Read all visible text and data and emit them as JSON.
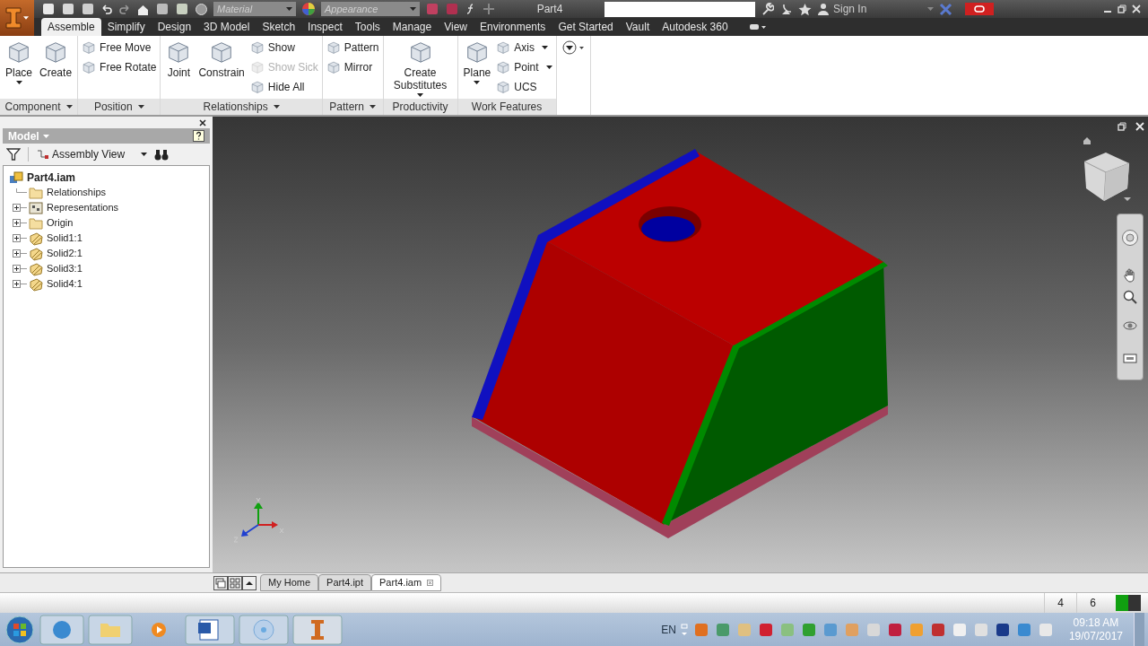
{
  "window": {
    "title": "Part4"
  },
  "quick_access": {
    "material": "Material",
    "appearance": "Appearance"
  },
  "title_bar": {
    "sign_in": "Sign In"
  },
  "tabs": [
    {
      "label": "Assemble",
      "selected": true
    },
    {
      "label": "Simplify",
      "selected": false
    },
    {
      "label": "Design",
      "selected": false
    },
    {
      "label": "3D Model",
      "selected": false
    },
    {
      "label": "Sketch",
      "selected": false
    },
    {
      "label": "Inspect",
      "selected": false
    },
    {
      "label": "Tools",
      "selected": false
    },
    {
      "label": "Manage",
      "selected": false
    },
    {
      "label": "View",
      "selected": false
    },
    {
      "label": "Environments",
      "selected": false
    },
    {
      "label": "Get Started",
      "selected": false
    },
    {
      "label": "Vault",
      "selected": false
    },
    {
      "label": "Autodesk 360",
      "selected": false
    }
  ],
  "ribbon": {
    "groups": [
      {
        "label": "Component",
        "dropdown": true,
        "columns": [
          [
            {
              "label": "Place",
              "kind": "large",
              "dropdown": true,
              "disabled": false
            }
          ],
          [
            {
              "label": "Create",
              "kind": "large",
              "dropdown": false,
              "disabled": false
            }
          ]
        ]
      },
      {
        "label": "Position",
        "dropdown": true,
        "columns": [
          [
            {
              "label": "Free Move",
              "kind": "small",
              "dropdown": false,
              "disabled": false
            },
            {
              "label": "Free Rotate",
              "kind": "small",
              "dropdown": false,
              "disabled": false
            }
          ]
        ]
      },
      {
        "label": "Relationships",
        "dropdown": true,
        "columns": [
          [
            {
              "label": "Joint",
              "kind": "large",
              "dropdown": false,
              "disabled": false
            }
          ],
          [
            {
              "label": "Constrain",
              "kind": "large",
              "dropdown": false,
              "disabled": false
            }
          ],
          [
            {
              "label": "Show",
              "kind": "small",
              "dropdown": false,
              "disabled": false
            },
            {
              "label": "Show Sick",
              "kind": "small",
              "dropdown": false,
              "disabled": true
            },
            {
              "label": "Hide All",
              "kind": "small",
              "dropdown": false,
              "disabled": false
            }
          ]
        ]
      },
      {
        "label": "Pattern",
        "dropdown": true,
        "columns": [
          [
            {
              "label": "Pattern",
              "kind": "small",
              "dropdown": false,
              "disabled": false
            },
            {
              "label": "Mirror",
              "kind": "small",
              "dropdown": false,
              "disabled": false
            }
          ]
        ]
      },
      {
        "label": "Productivity",
        "dropdown": false,
        "columns": [
          [
            {
              "label": "Create Substitutes",
              "kind": "large",
              "dropdown": true,
              "disabled": false
            }
          ]
        ]
      },
      {
        "label": "Work Features",
        "dropdown": false,
        "columns": [
          [
            {
              "label": "Plane",
              "kind": "large",
              "dropdown": true,
              "disabled": false
            }
          ],
          [
            {
              "label": "Axis",
              "kind": "small",
              "dropdown": true,
              "disabled": false
            },
            {
              "label": "Point",
              "kind": "small",
              "dropdown": true,
              "disabled": false
            },
            {
              "label": "UCS",
              "kind": "small",
              "dropdown": false,
              "disabled": false
            }
          ]
        ]
      }
    ]
  },
  "model_panel": {
    "title": "Model",
    "view": "Assembly View",
    "tree": [
      {
        "label": "Part4.iam",
        "kind": "assembly",
        "expandable": false,
        "children": [
          {
            "label": "Relationships",
            "kind": "folder",
            "expandable": false
          },
          {
            "label": "Representations",
            "kind": "representations",
            "expandable": true
          },
          {
            "label": "Origin",
            "kind": "folder",
            "expandable": true
          },
          {
            "label": "Solid1:1",
            "kind": "solid",
            "expandable": true
          },
          {
            "label": "Solid2:1",
            "kind": "solid",
            "expandable": true
          },
          {
            "label": "Solid3:1",
            "kind": "solid",
            "expandable": true
          },
          {
            "label": "Solid4:1",
            "kind": "solid",
            "expandable": true
          }
        ]
      }
    ]
  },
  "document_tabs": [
    {
      "label": "My Home",
      "selected": false
    },
    {
      "label": "Part4.ipt",
      "selected": false
    },
    {
      "label": "Part4.iam",
      "selected": true
    }
  ],
  "status_bar": {
    "counts": [
      "4",
      "6"
    ]
  },
  "taskbar": {
    "language": "EN",
    "time": "09:18 AM",
    "date": "19/07/2017"
  }
}
